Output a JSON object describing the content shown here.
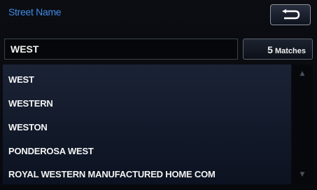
{
  "header": {
    "title": "Street Name",
    "back_icon": "return-arrow-icon"
  },
  "entry": {
    "value": "WEST"
  },
  "matches": {
    "count": "5",
    "label": "Matches"
  },
  "results": [
    {
      "label": "WEST"
    },
    {
      "label": "WESTERN"
    },
    {
      "label": "WESTON"
    },
    {
      "label": "PONDEROSA WEST"
    },
    {
      "label": "ROYAL WESTERN MANUFACTURED HOME COM"
    }
  ],
  "scrollbar": {
    "up_icon": "scroll-up-icon",
    "down_icon": "scroll-down-icon"
  },
  "colors": {
    "title": "#3f8ae6",
    "list_background": "#1a2235",
    "text": "#f4f4f4"
  }
}
